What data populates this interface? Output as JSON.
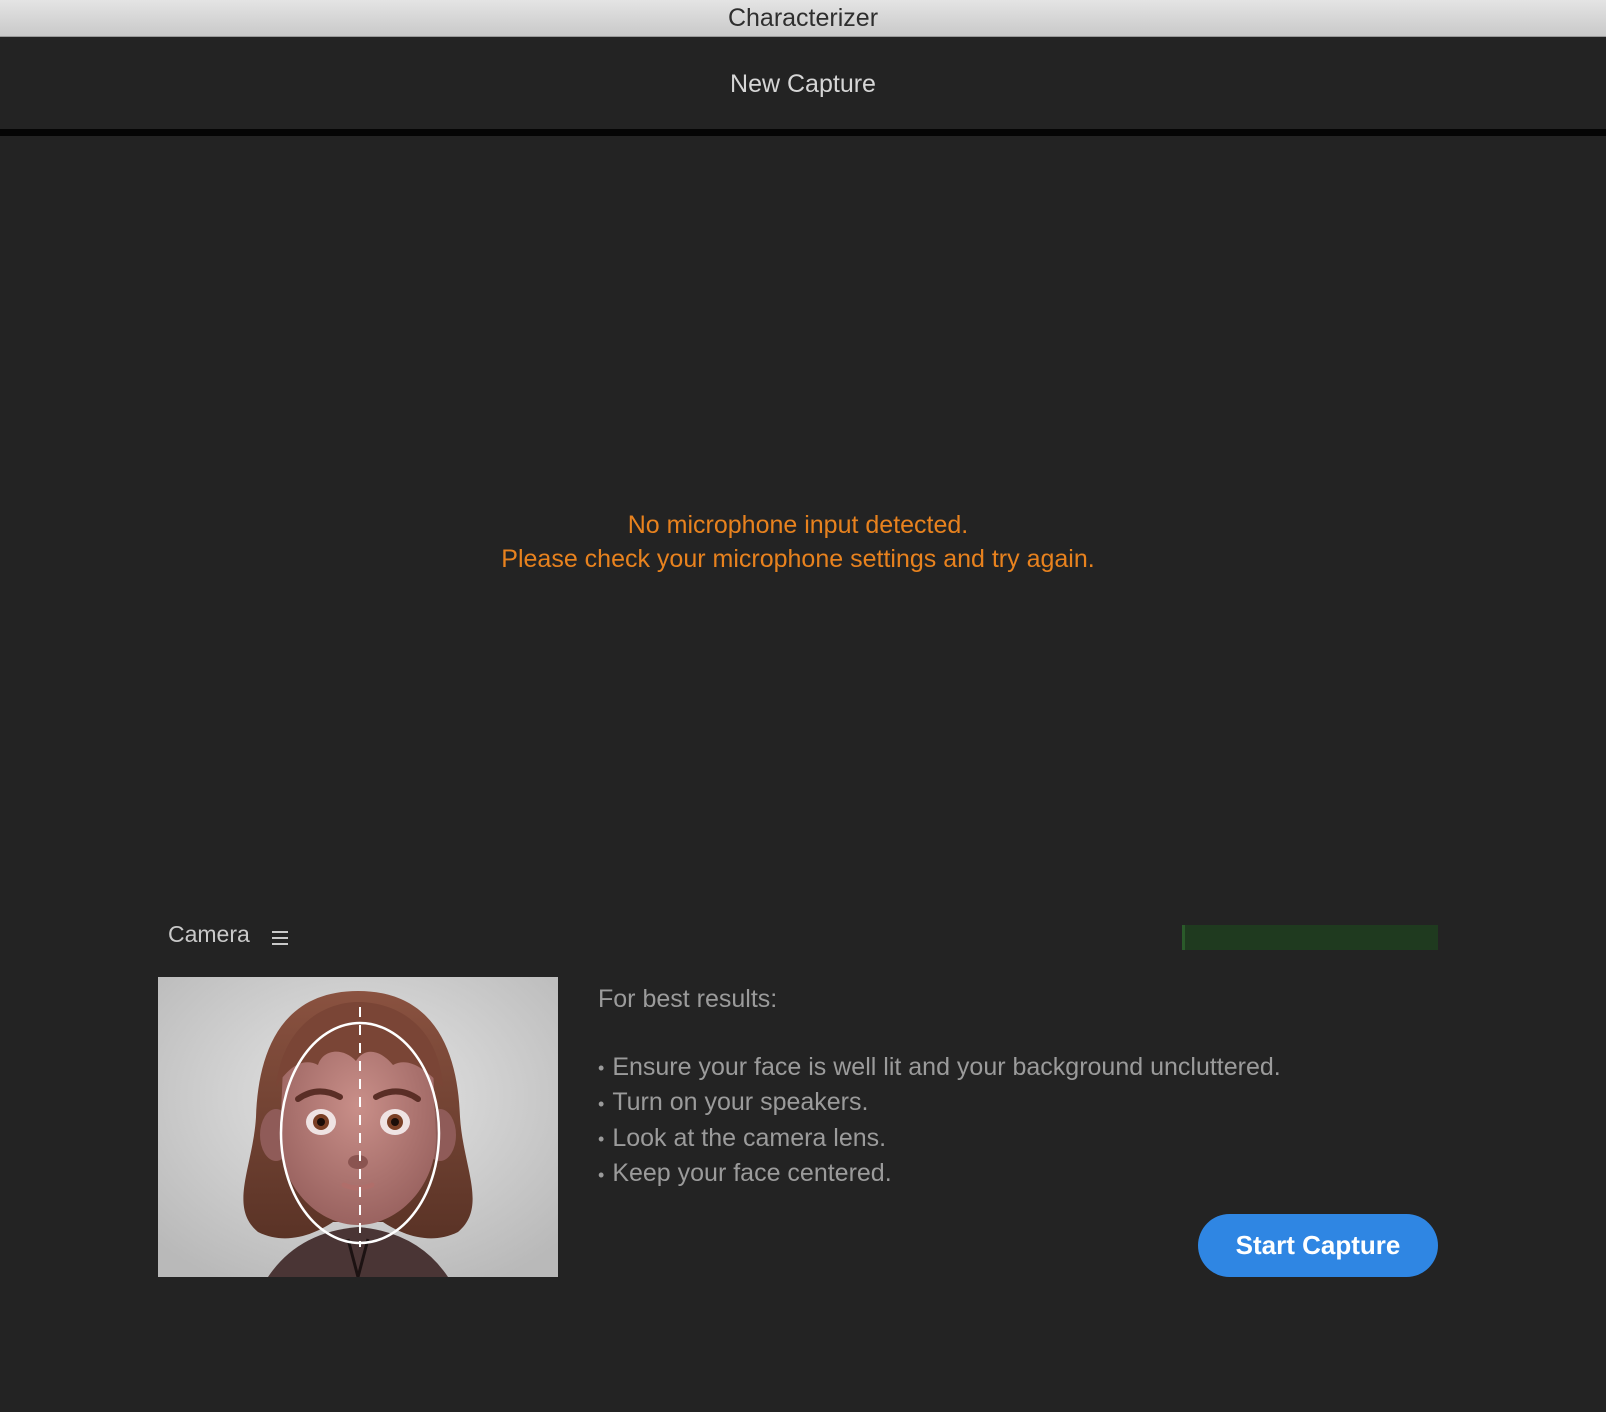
{
  "window": {
    "title": "Characterizer"
  },
  "header": {
    "title": "New Capture"
  },
  "warning": {
    "line1": "No microphone input detected.",
    "line2": "Please check your microphone settings and try again.",
    "color": "#e8821e"
  },
  "camera": {
    "label": "Camera",
    "menu_icon": "hamburger-menu-icon",
    "input_level": 0.01
  },
  "tips": {
    "heading": "For best results:",
    "bullet": "•",
    "items": [
      "Ensure your face is well lit and your background uncluttered.",
      "Turn on your speakers.",
      "Look at the camera lens.",
      "Keep your face centered."
    ]
  },
  "actions": {
    "start_capture": "Start Capture",
    "accent": "#2f86e3"
  },
  "colors": {
    "background": "#232323",
    "meter": "#1f3a1f"
  }
}
